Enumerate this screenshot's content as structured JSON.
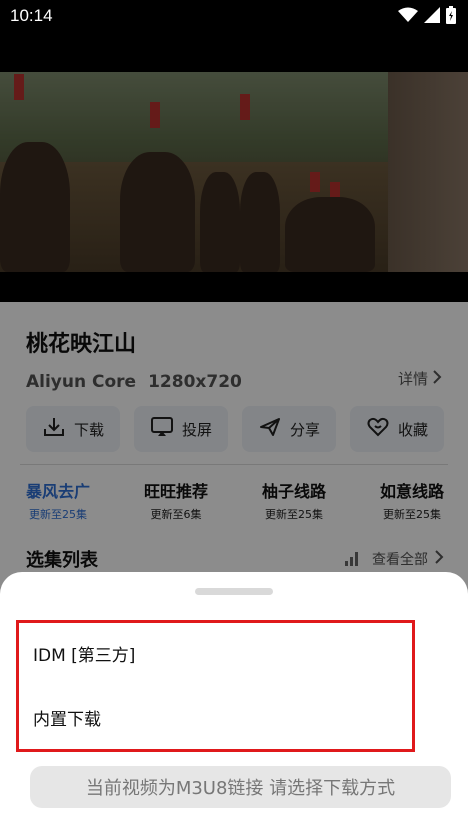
{
  "status_bar": {
    "time": "10:14",
    "icons": [
      "wifi-icon",
      "signal-icon",
      "battery-icon"
    ]
  },
  "video": {
    "scene": "mounted-soldiers"
  },
  "detail": {
    "title": "桃花映江山",
    "player": "Aliyun Core",
    "resolution": "1280x720",
    "more_detail": "详情",
    "actions": [
      {
        "label": "下载",
        "icon": "download-icon"
      },
      {
        "label": "投屏",
        "icon": "cast-icon"
      },
      {
        "label": "分享",
        "icon": "share-icon"
      },
      {
        "label": "收藏",
        "icon": "favorite-heart-icon"
      }
    ],
    "sources": [
      {
        "name": "暴风去广",
        "update": "更新至25集",
        "active": true
      },
      {
        "name": "旺旺推荐",
        "update": "更新至6集",
        "active": false
      },
      {
        "name": "柚子线路",
        "update": "更新至25集",
        "active": false
      },
      {
        "name": "如意线路",
        "update": "更新至25集",
        "active": false
      }
    ],
    "episodes_title": "选集列表",
    "view_all": "查看全部"
  },
  "sheet": {
    "options": [
      "IDM [第三方]",
      "内置下载"
    ],
    "notice": "当前视频为M3U8链接 请选择下载方式"
  },
  "colors": {
    "accent": "#2f6fd6",
    "highlight_border": "#e0191b",
    "action_bg": "#eef2f7"
  }
}
